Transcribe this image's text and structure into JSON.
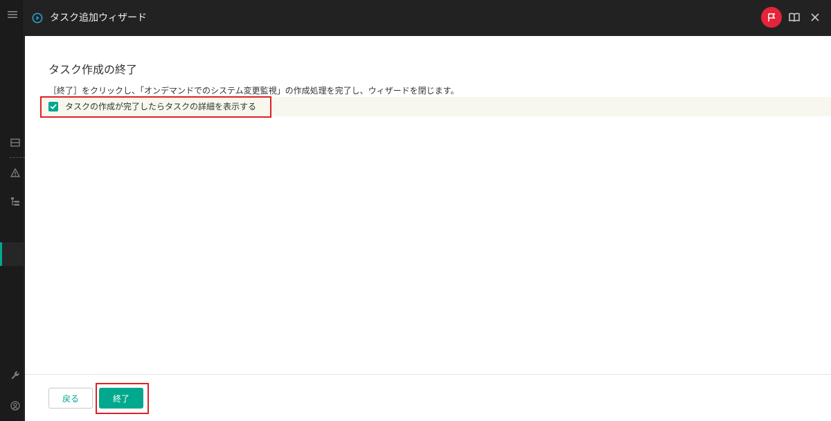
{
  "window": {
    "title": "タスク追加ウィザード"
  },
  "page": {
    "heading": "タスク作成の終了",
    "description": "［終了］をクリックし、「オンデマンドでのシステム変更監視」の作成処理を完了し、ウィザードを閉じます。",
    "checkbox": {
      "label": "タスクの作成が完了したらタスクの詳細を表示する",
      "checked": true
    }
  },
  "buttons": {
    "back": "戻る",
    "finish": "終了"
  },
  "sidebar": {
    "icons": [
      "menu-icon",
      "list-icon",
      "warning-icon",
      "hierarchy-icon",
      "wrench-icon",
      "user-icon"
    ]
  },
  "header_icons": [
    "play-circle-icon",
    "flag-icon",
    "book-icon",
    "close-icon"
  ],
  "colors": {
    "accent": "#00a88e",
    "titlebar": "#222222",
    "flag": "#e32439",
    "highlight": "#e01f25",
    "checkbox_row_bg": "#f7f7ee"
  }
}
